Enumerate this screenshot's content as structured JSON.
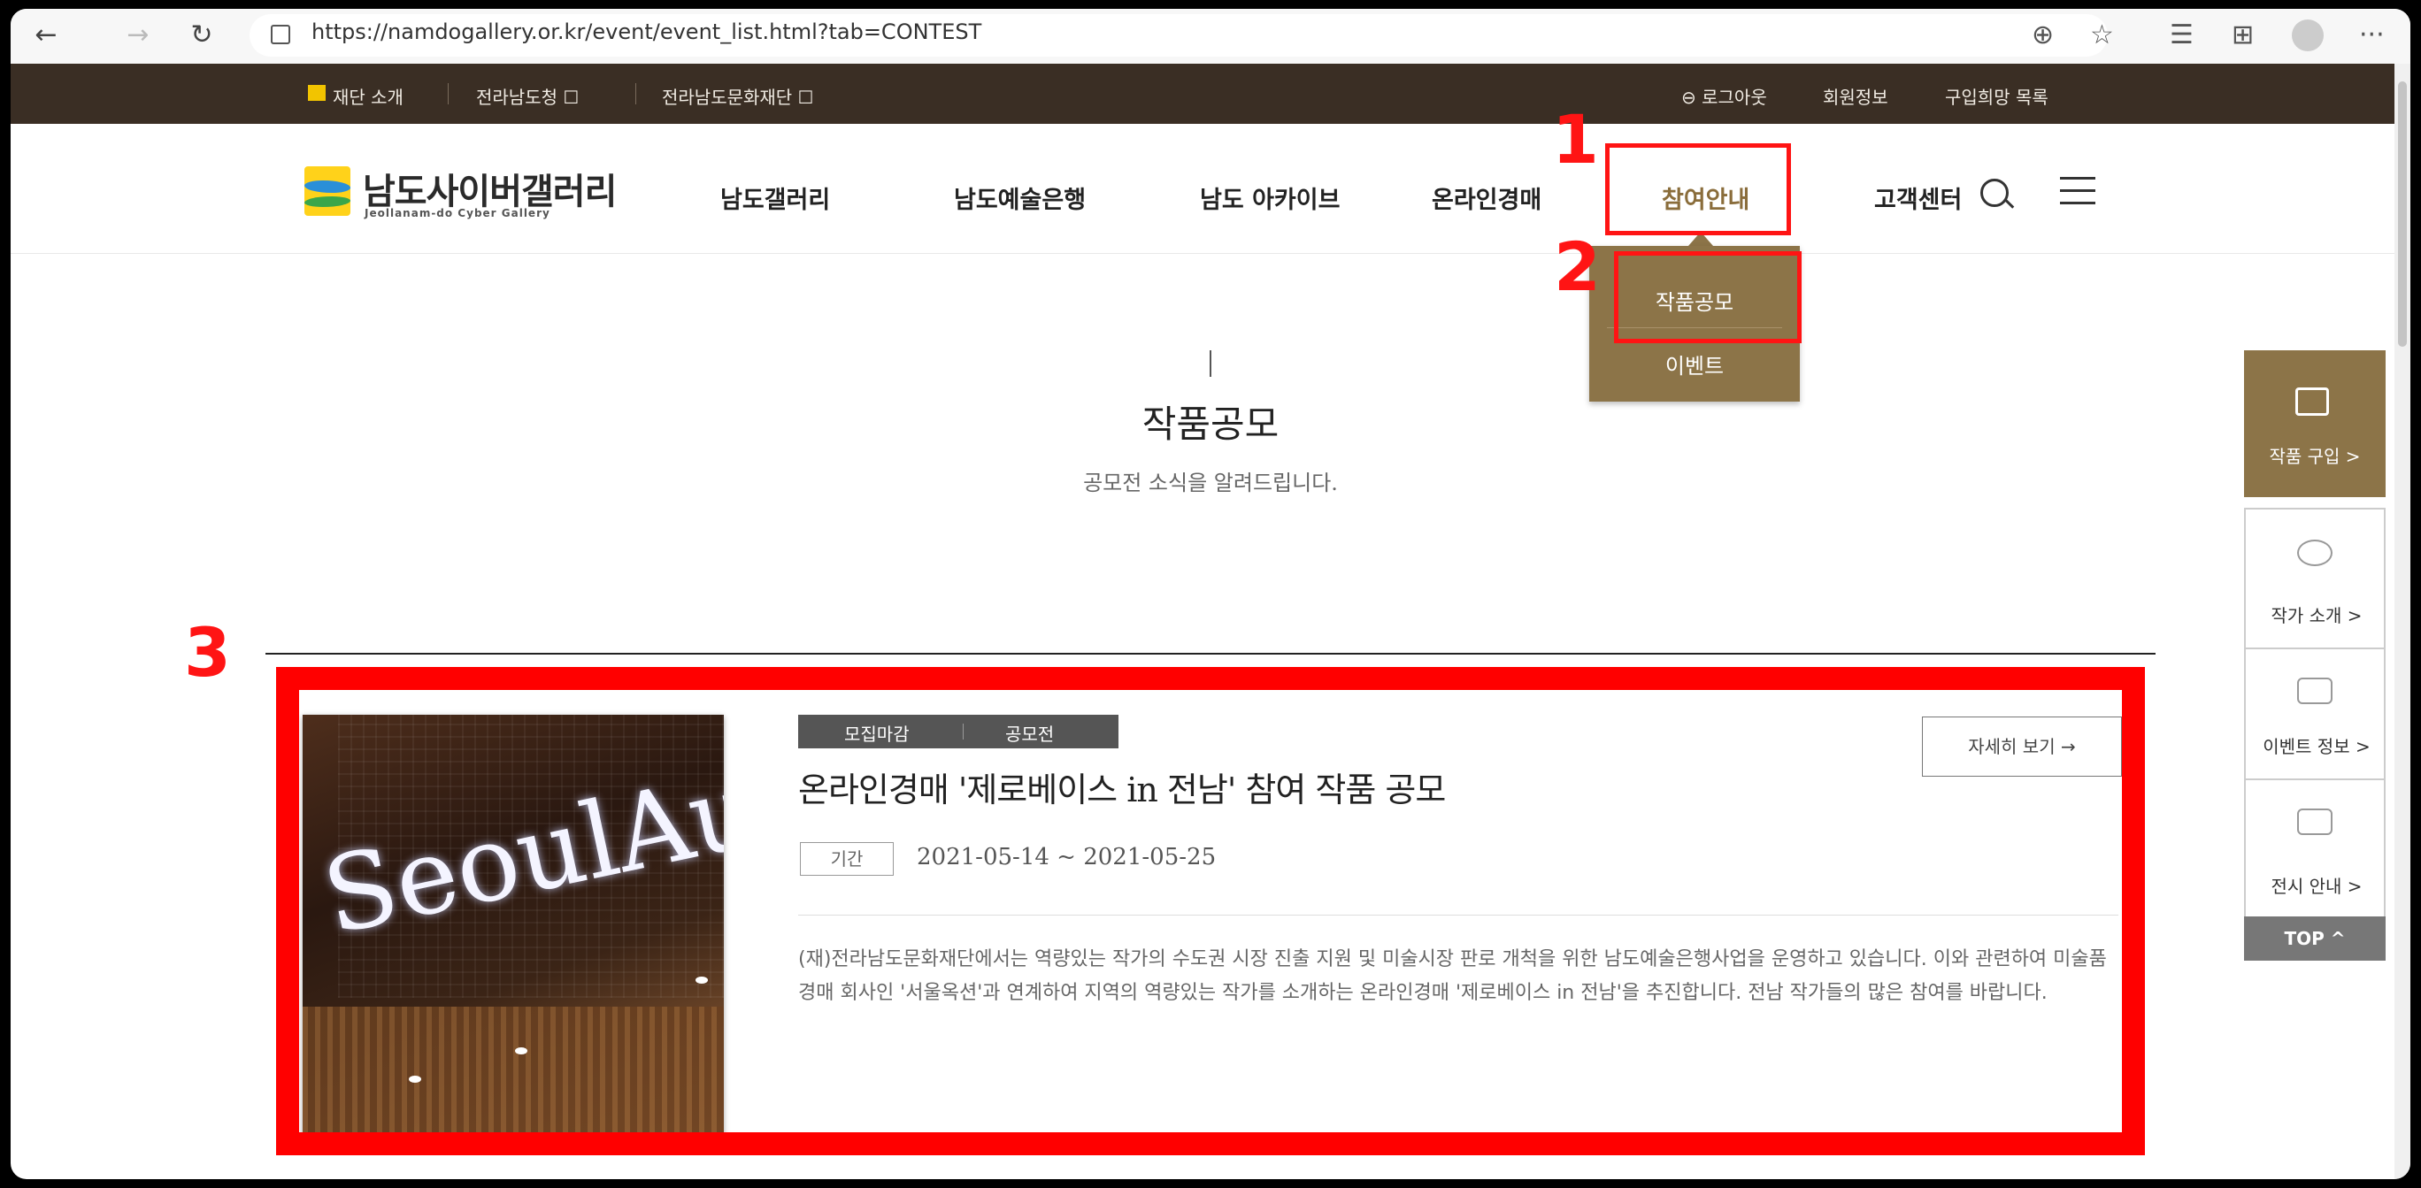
{
  "browser": {
    "back_icon": "←",
    "forward_icon": "→",
    "refresh_icon": "↻",
    "url": "https://namdogallery.or.kr/event/event_list.html?tab=CONTEST",
    "zoom_icon": "⊕",
    "fav_icon": "☆",
    "favorites_icon": "☰",
    "collections_icon": "⊞",
    "more_icon": "···"
  },
  "util_bar": {
    "left": [
      "재단 소개",
      "전라남도청 ☐",
      "전라남도문화재단 ☐"
    ],
    "right": [
      "⊖ 로그아웃",
      "회원정보",
      "구입희망 목록"
    ]
  },
  "site": {
    "logo_title": "남도사이버갤러리",
    "logo_sub": "Jeollanam-do Cyber Gallery"
  },
  "nav": [
    "남도갤러리",
    "남도예술은행",
    "남도 아카이브",
    "온라인경매",
    "참여안내",
    "고객센터"
  ],
  "dropdown": [
    "작품공모",
    "이벤트"
  ],
  "page": {
    "title": "작품공모",
    "subtitle": "공모전 소식을 알려드립니다."
  },
  "card": {
    "status": "모집마감",
    "category": "공모전",
    "title": "온라인경매 '제로베이스 in 전남' 참여 작품 공모",
    "period_label": "기간",
    "period": "2021-05-14 ~ 2021-05-25",
    "description": "(재)전라남도문화재단에서는 역량있는 작가의 수도권 시장 진출 지원 및 미술시장 판로 개척을 위한 남도예술은행사업을 운영하고 있습니다. 이와 관련하여 미술품 경매 회사인 '서울옥션'과 연계하여 지역의 역량있는 작가를 소개하는 온라인경매 '제로베이스 in 전남'을 추진합니다. 전남 작가들의 많은 참여를 바랍니다.",
    "more_label": "자세히 보기 →",
    "image_text": "SeoulAuct"
  },
  "quick_menu": [
    "작품 구입 >",
    "작가 소개 >",
    "이벤트 정보 >",
    "전시 안내 >",
    "TOP ^"
  ],
  "annotations": [
    "1",
    "2",
    "3"
  ],
  "colors": {
    "brand_gold": "#8c7448",
    "util_bar": "#3a2e24",
    "annotation_red": "#ff1414"
  }
}
